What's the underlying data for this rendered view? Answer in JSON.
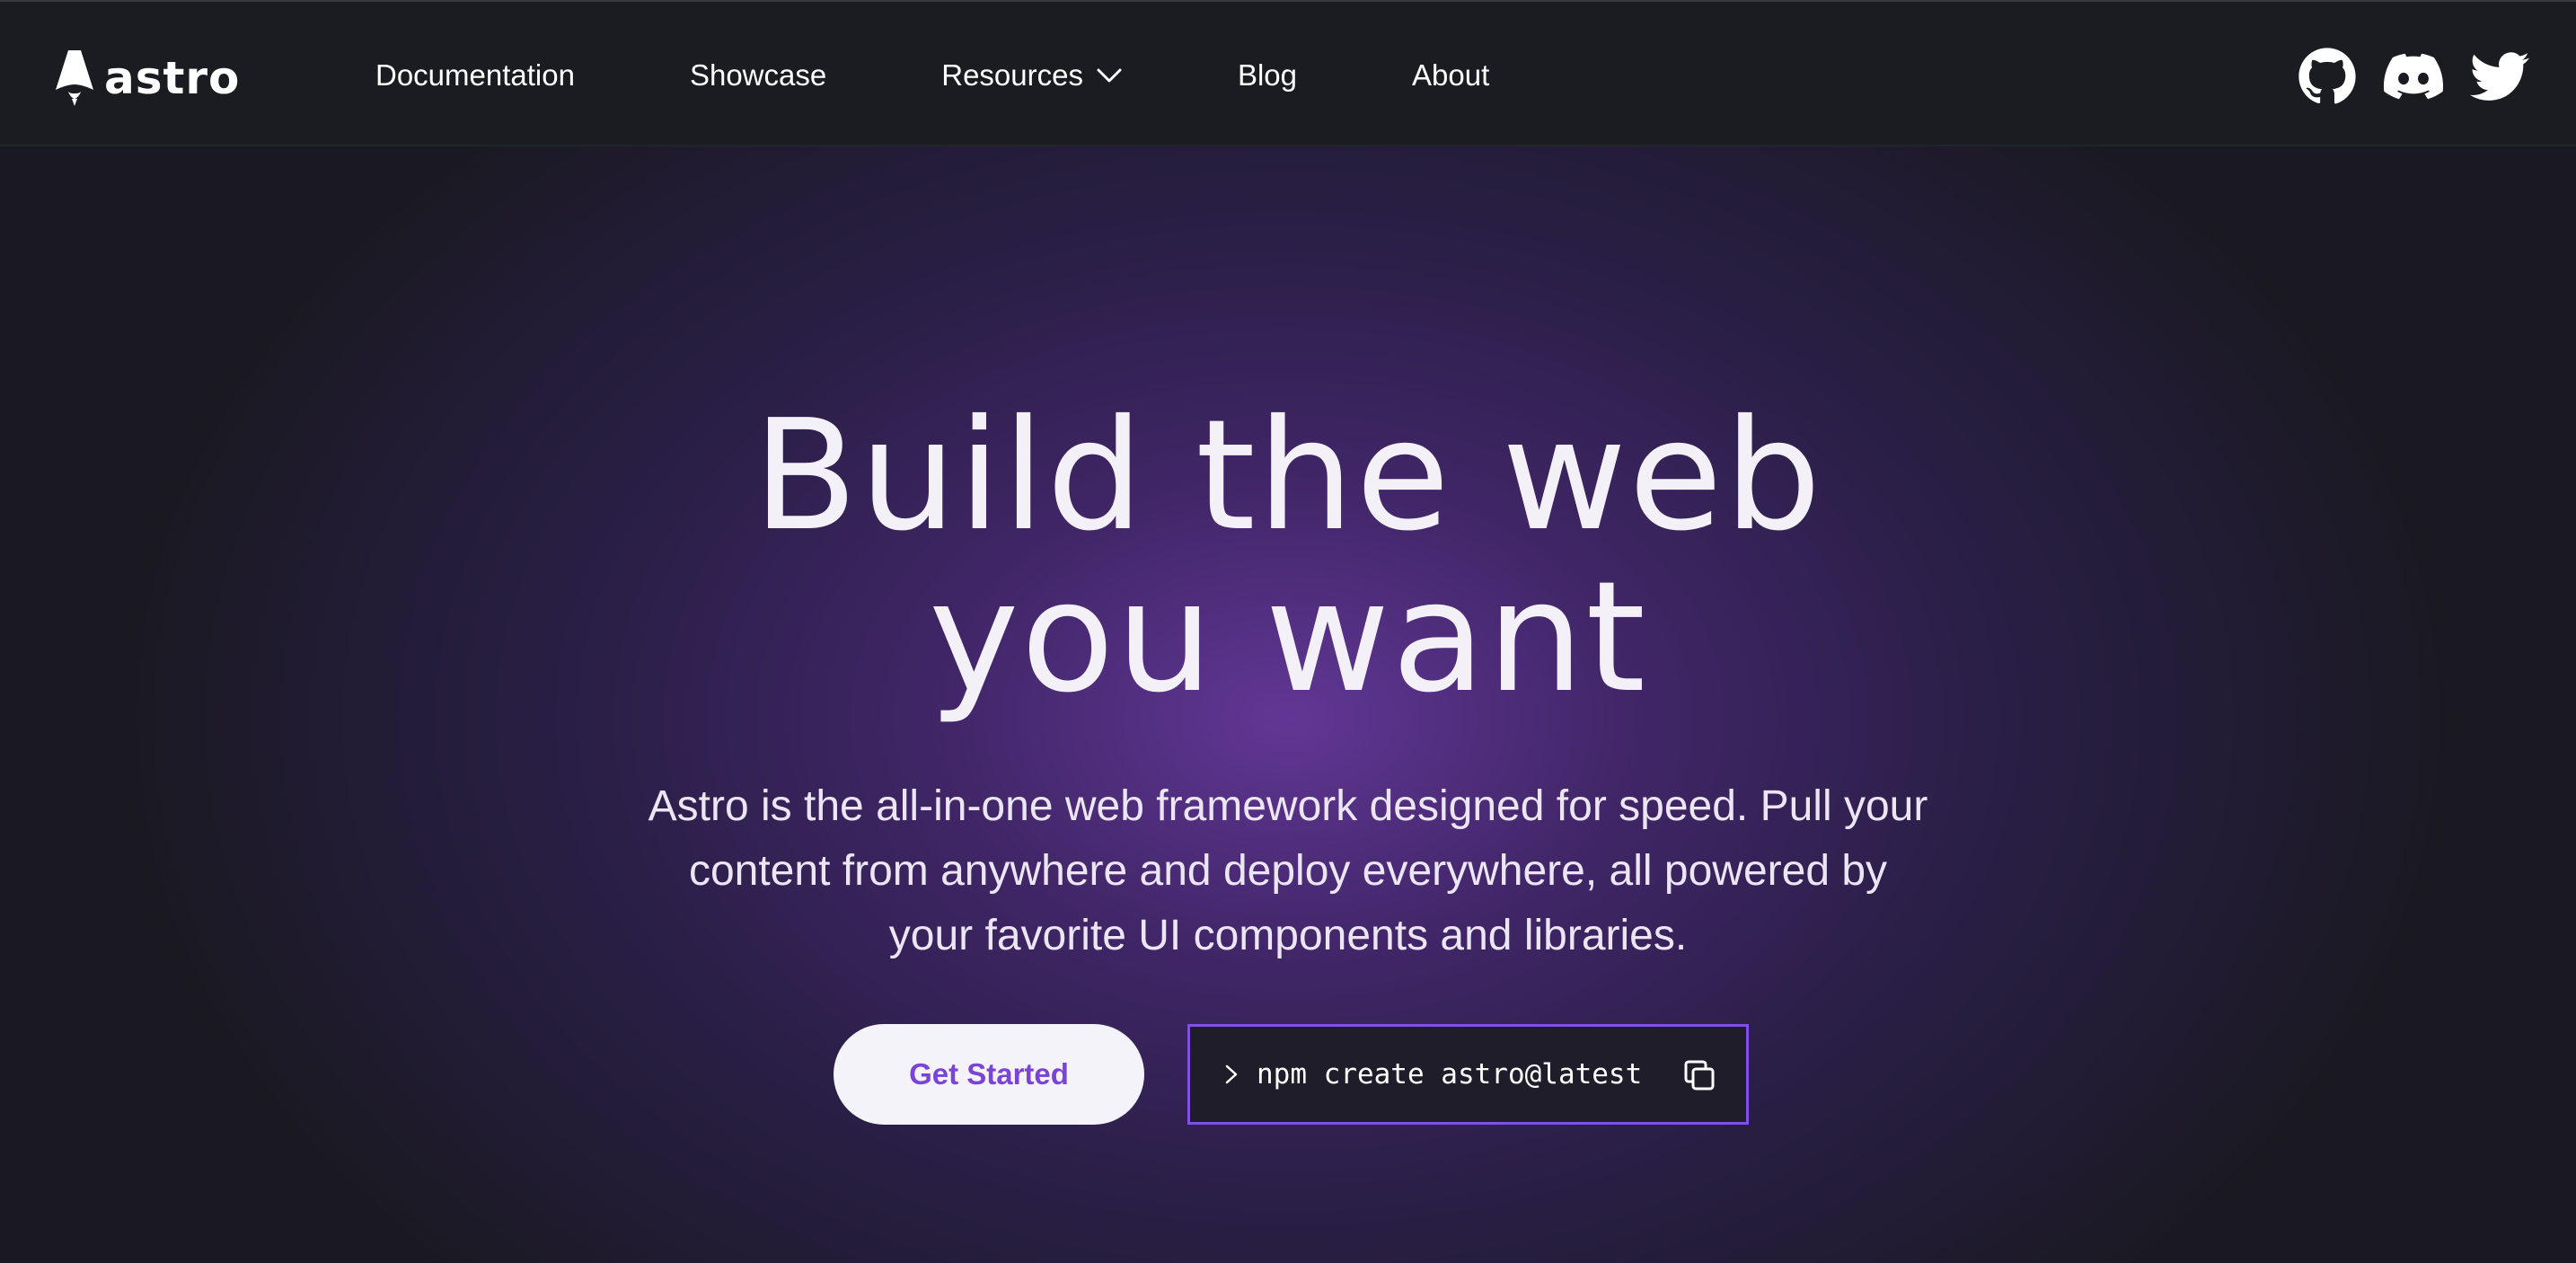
{
  "logo": {
    "text": "astro",
    "icon": "astro-rocket-icon"
  },
  "nav": {
    "items": [
      {
        "label": "Documentation"
      },
      {
        "label": "Showcase"
      },
      {
        "label": "Resources",
        "icon": "chevron-down-icon"
      },
      {
        "label": "Blog"
      },
      {
        "label": "About"
      }
    ]
  },
  "socials": [
    {
      "name": "GitHub",
      "icon": "github-icon"
    },
    {
      "name": "Discord",
      "icon": "discord-icon"
    },
    {
      "name": "Twitter",
      "icon": "twitter-icon"
    }
  ],
  "hero": {
    "title_line1": "Build the web",
    "title_line2": "you want",
    "subtitle": "Astro is the all-in-one web framework designed for speed. Pull your content from anywhere and deploy everywhere, all powered by your favorite UI components and libraries.",
    "cta_label": "Get Started",
    "command": "npm create astro@latest",
    "command_prompt_icon": "chevron-right-icon",
    "copy_icon": "copy-icon"
  },
  "colors": {
    "nav_bg": "#1b1c21",
    "accent": "#8250e6",
    "cta_text": "#7a45d6",
    "cta_bg": "#f4f3fa"
  }
}
